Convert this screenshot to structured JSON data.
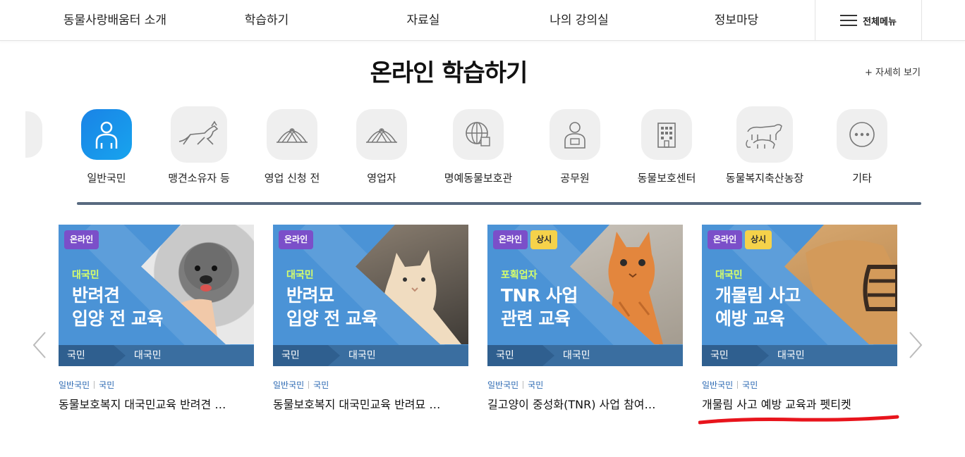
{
  "nav": {
    "items": [
      "동물사랑배움터 소개",
      "학습하기",
      "자료실",
      "나의 강의실",
      "정보마당"
    ],
    "all_menu": "전체메뉴"
  },
  "heading": {
    "title": "온라인 학습하기",
    "more": "+ 자세히 보기"
  },
  "categories": [
    {
      "label": "일반국민",
      "icon": "person-icon",
      "active": true
    },
    {
      "label": "맹견소유자 등",
      "icon": "running-dog-icon"
    },
    {
      "label": "영업 신청 전",
      "icon": "handshake-icon"
    },
    {
      "label": "영업자",
      "icon": "handshake-icon"
    },
    {
      "label": "명예동물보호관",
      "icon": "globe-icon"
    },
    {
      "label": "공무원",
      "icon": "officer-icon"
    },
    {
      "label": "동물보호센터",
      "icon": "building-icon"
    },
    {
      "label": "동물복지축산농장",
      "icon": "livestock-icon"
    },
    {
      "label": "기타",
      "icon": "more-icon"
    }
  ],
  "cards": [
    {
      "badges": [
        "온라인"
      ],
      "subtitle": "대국민",
      "heading": "반려견\n입양 전 교육",
      "foot_left": "국민",
      "foot_right": "대국민",
      "meta": [
        "일반국민",
        "국민"
      ],
      "title": "동물보호복지 대국민교육 반려견 입양 전 교육",
      "photo": "poodle-photo"
    },
    {
      "badges": [
        "온라인"
      ],
      "subtitle": "대국민",
      "heading": "반려묘\n입양 전 교육",
      "foot_left": "국민",
      "foot_right": "대국민",
      "meta": [
        "일반국민",
        "국민"
      ],
      "title": "동물보호복지 대국민교육 반려묘 입양 전 교육",
      "photo": "cream-cat-photo"
    },
    {
      "badges": [
        "온라인",
        "상시"
      ],
      "subtitle": "포획업자",
      "heading": "TNR 사업\n관련 교육",
      "foot_left": "국민",
      "foot_right": "대국민",
      "meta": [
        "일반국민",
        "국민"
      ],
      "title": "길고양이 중성화(TNR) 사업 참여자 교육",
      "photo": "orange-kitten-photo"
    },
    {
      "badges": [
        "온라인",
        "상시"
      ],
      "subtitle": "대국민",
      "heading": "개물림 사고\n예방 교육",
      "foot_left": "국민",
      "foot_right": "대국민",
      "meta": [
        "일반국민",
        "국민"
      ],
      "title": "개물림 사고 예방 교육과 펫티켓",
      "photo": "muzzled-dog-photo"
    }
  ],
  "colors": {
    "accent": "#1a83e6",
    "card_bg": "#4b93d6",
    "badge_online": "#7b4fc9",
    "badge_always": "#f5d24a",
    "bar": "#586a80",
    "annotation_red": "#e8141c"
  }
}
